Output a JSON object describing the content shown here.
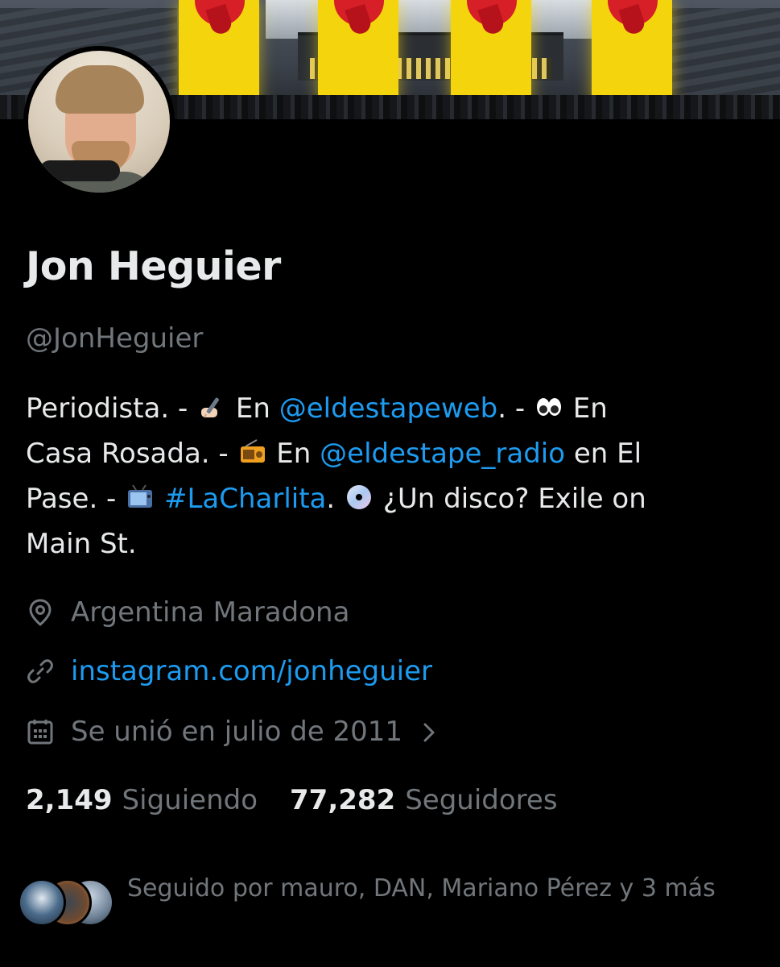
{
  "profile": {
    "name": "Jon Heguier",
    "handle": "@JonHeguier",
    "bio": {
      "line1": {
        "t1": "Periodista. - ",
        "t2": " En ",
        "mention1": "@eldestapeweb",
        "t3": ". - ",
        "t4": " En"
      },
      "line2": {
        "t1": "Casa Rosada. - ",
        "t2": " En ",
        "mention2": "@eldestape_radio",
        "t3": " en El"
      },
      "line3": {
        "t1": "Pase. - ",
        "hashtag": "#LaCharlita",
        "t2": ". ",
        "t3": " ¿Un disco? Exile on"
      },
      "line4": {
        "t1": "Main St."
      }
    },
    "location": "Argentina Maradona",
    "website": "instagram.com/jonheguier",
    "joined": "Se unió en julio de 2011",
    "following_count": "2,149",
    "following_label": "Siguiendo",
    "followers_count": "77,282",
    "followers_label": "Seguidores",
    "followed_by": "Seguido por mauro, DAN, Mariano Pérez y 3 más"
  },
  "icons": {
    "location": "location-pin-icon",
    "link": "link-icon",
    "calendar": "calendar-icon",
    "chevron": "chevron-right-icon",
    "emojis": [
      "writing-hand-emoji",
      "eyes-emoji",
      "radio-emoji",
      "tv-emoji",
      "dvd-emoji"
    ]
  },
  "colors": {
    "background": "#000000",
    "text_primary": "#e7e9ea",
    "text_secondary": "#71767b",
    "link": "#1d9bf0"
  }
}
